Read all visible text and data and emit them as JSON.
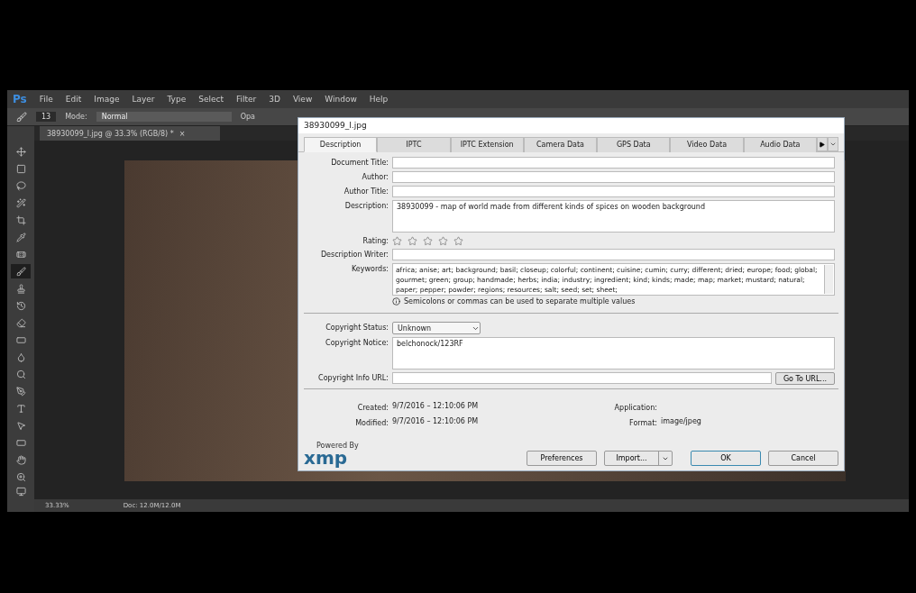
{
  "app": {
    "logo": "Ps",
    "menu": [
      "File",
      "Edit",
      "Image",
      "Layer",
      "Type",
      "Select",
      "Filter",
      "3D",
      "View",
      "Window",
      "Help"
    ]
  },
  "options_bar": {
    "brush_size": "13",
    "mode_label": "Mode:",
    "mode_value": "Normal",
    "opacity_label": "Opa"
  },
  "document_tab": {
    "title": "38930099_l.jpg @ 33.3% (RGB/8) *",
    "close": "×"
  },
  "tools": [
    {
      "selected": false
    },
    {
      "selected": false
    },
    {
      "selected": false
    },
    {
      "selected": false
    },
    {
      "selected": false
    },
    {
      "selected": false
    },
    {
      "selected": false
    },
    {
      "selected": true
    },
    {
      "selected": false
    },
    {
      "selected": false
    },
    {
      "selected": false
    },
    {
      "selected": false
    },
    {
      "selected": false
    },
    {
      "selected": false
    },
    {
      "selected": false
    },
    {
      "selected": false
    },
    {
      "selected": false
    },
    {
      "selected": false
    },
    {
      "selected": false
    },
    {
      "selected": false
    }
  ],
  "status_bar": {
    "zoom": "33.33%",
    "doc": "Doc: 12.0M/12.0M"
  },
  "dialog": {
    "title": "38930099_l.jpg",
    "tabs": [
      {
        "label": "Description",
        "selected": true
      },
      {
        "label": "IPTC",
        "selected": false
      },
      {
        "label": "IPTC Extension",
        "selected": false
      },
      {
        "label": "Camera Data",
        "selected": false
      },
      {
        "label": "GPS Data",
        "selected": false
      },
      {
        "label": "Video Data",
        "selected": false
      },
      {
        "label": "Audio Data",
        "selected": false
      }
    ],
    "fields": [
      {
        "label": "Document Title:",
        "kind": "line"
      },
      {
        "label": "Author:",
        "kind": "line"
      },
      {
        "label": "Author Title:",
        "kind": "line"
      },
      {
        "label": "Description:",
        "value": "38930099 - map of world made from different kinds of spices on wooden background",
        "kind": "area"
      }
    ],
    "rating": {
      "label": "Rating:",
      "stars": 0
    },
    "description_writer": {
      "label": "Description Writer:"
    },
    "keywords": {
      "label": "Keywords:",
      "value": "africa; anise; art; background; basil; closeup; colorful; continent; cuisine; cumin; curry; different; dried; europe; food; global; gourmet; green; group; handmade; herbs; india; industry; ingredient; kind; kinds; made; map; market; mustard; natural; paper; pepper; powder; regions; resources; salt; seed; set; sheet;"
    },
    "hint": "Semicolons or commas can be used to separate multiple values",
    "copyright_status": {
      "label": "Copyright Status:",
      "value": "Unknown"
    },
    "copyright_notice": {
      "label": "Copyright Notice:",
      "value": "belchonock/123RF"
    },
    "copyright_url": {
      "label": "Copyright Info URL:",
      "button": "Go To URL..."
    },
    "info": [
      {
        "label": "Created:",
        "value": "9/7/2016 – 12:10:06 PM"
      },
      {
        "label": "Application:"
      },
      {
        "label": "Modified:",
        "value": "9/7/2016 – 12:10:06 PM"
      },
      {
        "label": "Format:",
        "value": "image/jpeg"
      }
    ],
    "logo": {
      "caption": "Powered By",
      "mark": "xmp"
    },
    "buttons": {
      "preferences": "Preferences",
      "import": "Import...",
      "ok": "OK",
      "cancel": "Cancel"
    }
  }
}
